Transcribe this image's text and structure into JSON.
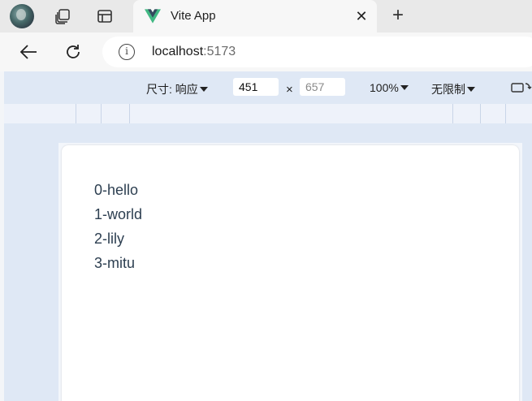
{
  "browser": {
    "tab": {
      "title": "Vite App",
      "close_glyph": "✕"
    },
    "new_tab_glyph": "+",
    "address": {
      "host": "localhost",
      "port": ":5173"
    }
  },
  "devtools": {
    "size_label": "尺寸: 响应",
    "width_value": "451",
    "height_placeholder": "657",
    "times": "×",
    "zoom_label": "100%",
    "throttle_label": "无限制"
  },
  "page": {
    "items": [
      "0-hello",
      "1-world",
      "2-lily",
      "3-mitu"
    ]
  },
  "colors": {
    "vue_green": "#41b883",
    "vue_dark": "#35495e",
    "text": "#2c3e50"
  }
}
